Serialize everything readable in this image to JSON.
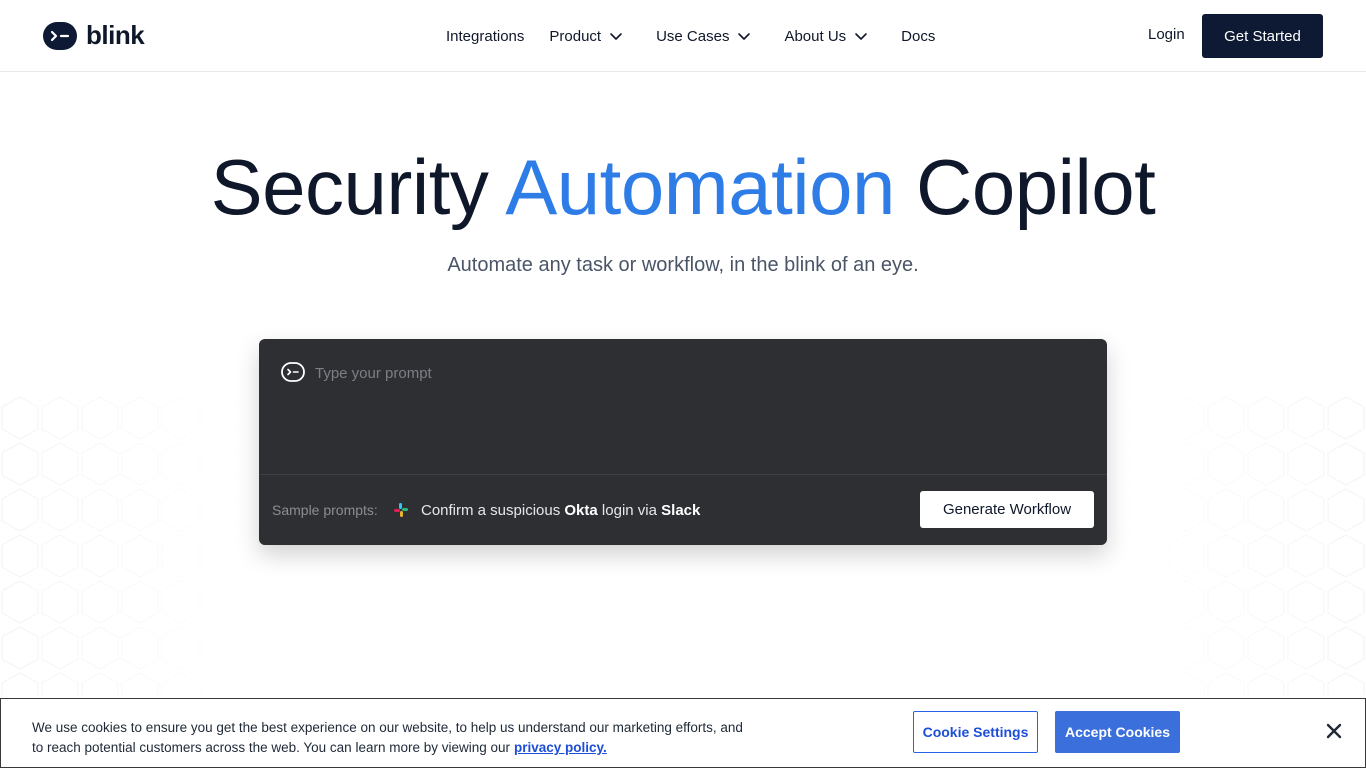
{
  "header": {
    "logo_text": "blink",
    "nav": [
      {
        "label": "Integrations",
        "has_dropdown": false
      },
      {
        "label": "Product",
        "has_dropdown": true
      },
      {
        "label": "Use Cases",
        "has_dropdown": true
      },
      {
        "label": "About Us",
        "has_dropdown": true
      },
      {
        "label": "Docs",
        "has_dropdown": false
      }
    ],
    "login_label": "Login",
    "cta_label": "Get Started"
  },
  "hero": {
    "title_part1": "Security",
    "title_accent": "Automation",
    "title_part2": "Copilot",
    "subtitle": "Automate any task or workflow, in the blink of an eye."
  },
  "prompt": {
    "placeholder": "Type your prompt",
    "sample_label": "Sample prompts:",
    "sample_prefix": "Confirm a suspicious",
    "sample_app1": "Okta",
    "sample_middle": "login via",
    "sample_app2": "Slack",
    "generate_label": "Generate Workflow"
  },
  "cookie_banner": {
    "text": "We use cookies to ensure you get the best experience on our website, to help us understand our marketing efforts, and to reach potential customers across the web. You can learn more by viewing our",
    "link_label": "privacy policy.",
    "settings_label": "Cookie Settings",
    "accept_label": "Accept Cookies"
  },
  "colors": {
    "navy": "#0e1a33",
    "accent_blue": "#2e7ce6",
    "prompt_bg": "#2e2f33",
    "cookie_blue": "#3a6fdc"
  },
  "icons": [
    "blink-logo-icon",
    "chevron-down-icon",
    "bot-icon",
    "slack-icon",
    "close-icon"
  ]
}
